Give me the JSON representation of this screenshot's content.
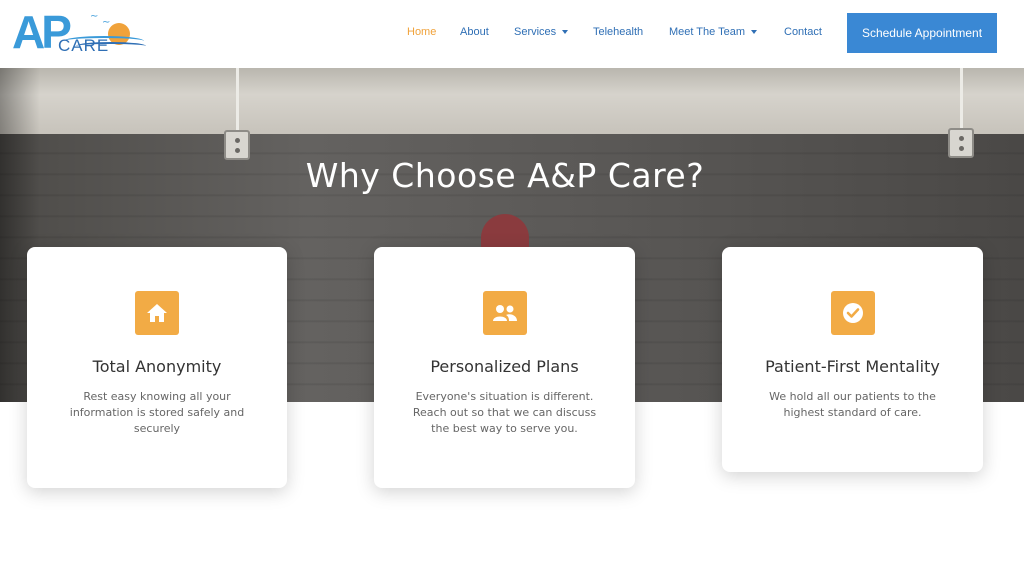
{
  "brand": {
    "logo_letters": "AP",
    "logo_word": "CARE",
    "colors": {
      "primary": "#3a88d4",
      "accent": "#f0a23a"
    }
  },
  "nav": {
    "items": [
      {
        "label": "Home",
        "active": true,
        "has_dropdown": false
      },
      {
        "label": "About",
        "active": false,
        "has_dropdown": false
      },
      {
        "label": "Services",
        "active": false,
        "has_dropdown": true
      },
      {
        "label": "Telehealth",
        "active": false,
        "has_dropdown": false
      },
      {
        "label": "Meet The Team",
        "active": false,
        "has_dropdown": true
      },
      {
        "label": "Contact",
        "active": false,
        "has_dropdown": false
      }
    ],
    "cta_label": "Schedule Appointment"
  },
  "hero": {
    "title": "Why Choose A&P Care?"
  },
  "features": [
    {
      "icon": "home-icon",
      "title": "Total Anonymity",
      "text": "Rest easy knowing all your information is stored safely and securely"
    },
    {
      "icon": "users-icon",
      "title": "Personalized Plans",
      "text": "Everyone's situation is different. Reach out so that we can discuss the best way to serve you."
    },
    {
      "icon": "check-circle-icon",
      "title": "Patient-First Mentality",
      "text": "We hold all our patients to the highest standard of care."
    }
  ]
}
